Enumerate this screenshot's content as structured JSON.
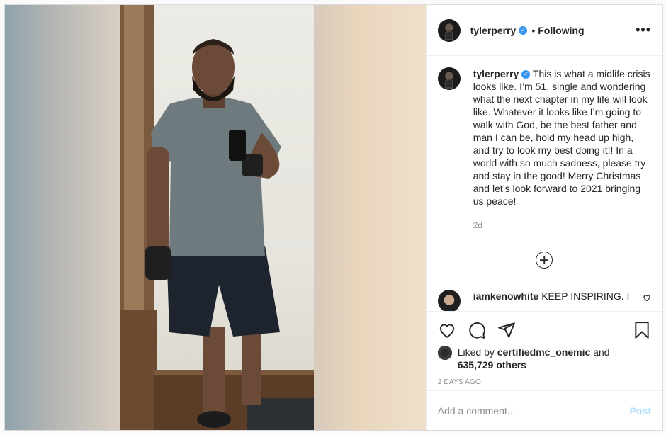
{
  "header": {
    "username": "tylerperry",
    "verified_badge": "✓",
    "separator": "•",
    "follow_status": "Following",
    "more_icon": "more-dots-icon",
    "more_label": "•••"
  },
  "caption": {
    "username": "tylerperry",
    "text": "This is what a midlife crisis looks like. I’m 51, single and wondering what the next chapter in my life will look like. Whatever it looks like I’m going to walk with God, be the best father and man I can be, hold my head up high, and try to look my best doing it!! In a world with so much sadness, please try and stay in the good! Merry Christmas and let’s look forward to 2021 bringing us peace!",
    "time": "2d"
  },
  "comments": [
    {
      "username": "iamkenowhite",
      "text": "KEEP INSPIRING. I WAS ON HIS SET NOT TOO LONG"
    }
  ],
  "actions": {
    "like_icon": "heart-icon",
    "comment_icon": "comment-icon",
    "share_icon": "share-icon",
    "save_icon": "bookmark-icon"
  },
  "likes": {
    "prefix": "Liked by",
    "user": "certifiedmc_onemic",
    "conjunction": "and",
    "count": "635,729 others"
  },
  "post_date": "2 DAYS AGO",
  "add_comment": {
    "placeholder": "Add a comment...",
    "post_label": "Post"
  },
  "colors": {
    "verified": "#3897f0",
    "post_button_disabled": "#b2dffc",
    "muted_text": "#8e8e8e"
  }
}
